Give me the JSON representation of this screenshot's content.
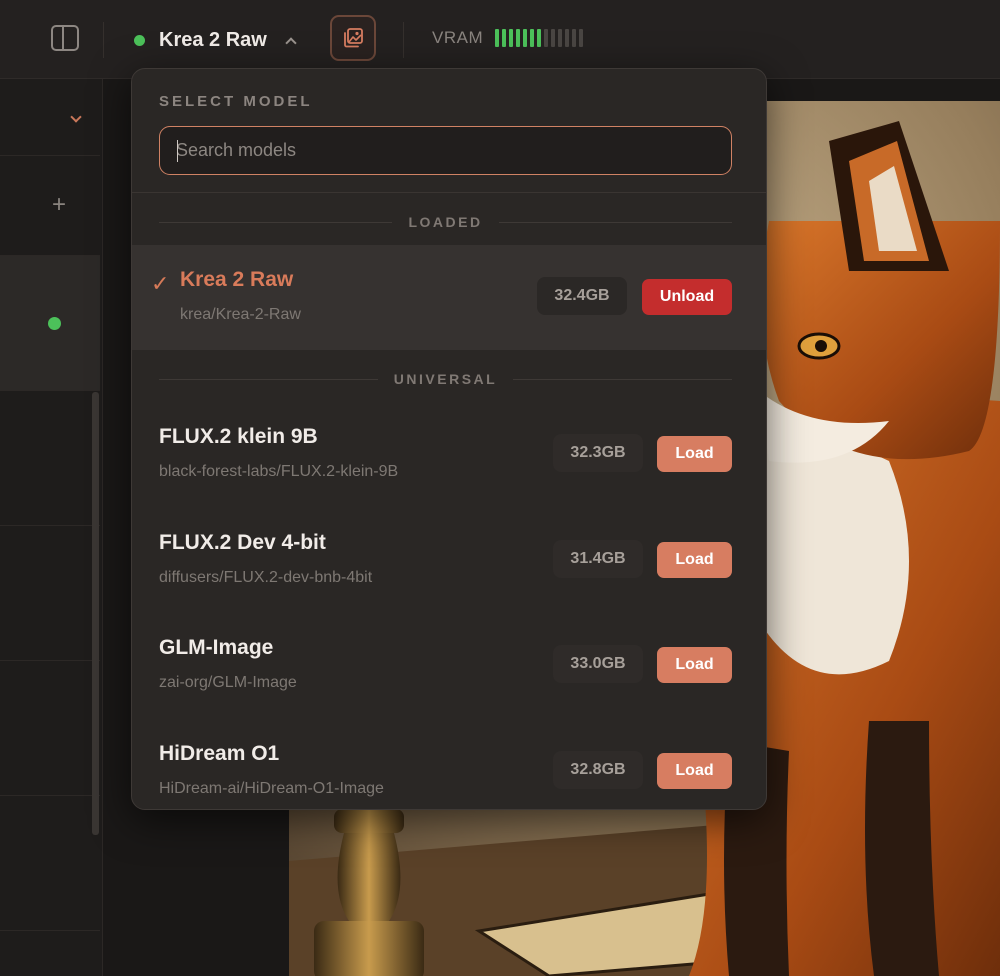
{
  "topbar": {
    "current_model": "Krea 2 Raw",
    "vram_label": "VRAM",
    "vram_usage": {
      "filled": 7,
      "total": 13
    },
    "colors": {
      "status_loaded": "#4cc15a",
      "accent": "#d77d61"
    }
  },
  "icons": {
    "sidebar_toggle": "sidebar-toggle-icon",
    "model_status": "status-dot-icon",
    "dropdown_chevron": "chevron-up-icon",
    "gallery": "image-gallery-icon",
    "sidebar_chevron": "chevron-down-icon",
    "sidebar_add": "plus-icon",
    "loaded_check": "checkmark-icon"
  },
  "dropdown": {
    "heading": "SELECT MODEL",
    "search_placeholder": "Search models",
    "sections": [
      {
        "label": "LOADED",
        "models": [
          {
            "name": "Krea 2 Raw",
            "repo": "krea/Krea-2-Raw",
            "size": "32.4GB",
            "action": "Unload",
            "loaded": true
          }
        ]
      },
      {
        "label": "UNIVERSAL",
        "models": [
          {
            "name": "FLUX.2 klein 9B",
            "repo": "black-forest-labs/FLUX.2-klein-9B",
            "size": "32.3GB",
            "action": "Load",
            "loaded": false
          },
          {
            "name": "FLUX.2 Dev 4-bit",
            "repo": "diffusers/FLUX.2-dev-bnb-4bit",
            "size": "31.4GB",
            "action": "Load",
            "loaded": false
          },
          {
            "name": "GLM-Image",
            "repo": "zai-org/GLM-Image",
            "size": "33.0GB",
            "action": "Load",
            "loaded": false
          },
          {
            "name": "HiDream O1",
            "repo": "HiDream-ai/HiDream-O1-Image",
            "size": "32.8GB",
            "action": "Load",
            "loaded": false
          }
        ]
      }
    ],
    "colors": {
      "unload_button": "#c42d2d",
      "load_button": "#d77d61",
      "loaded_title": "#d97b5a"
    }
  },
  "canvas": {
    "image_subject": "fox illustration"
  }
}
